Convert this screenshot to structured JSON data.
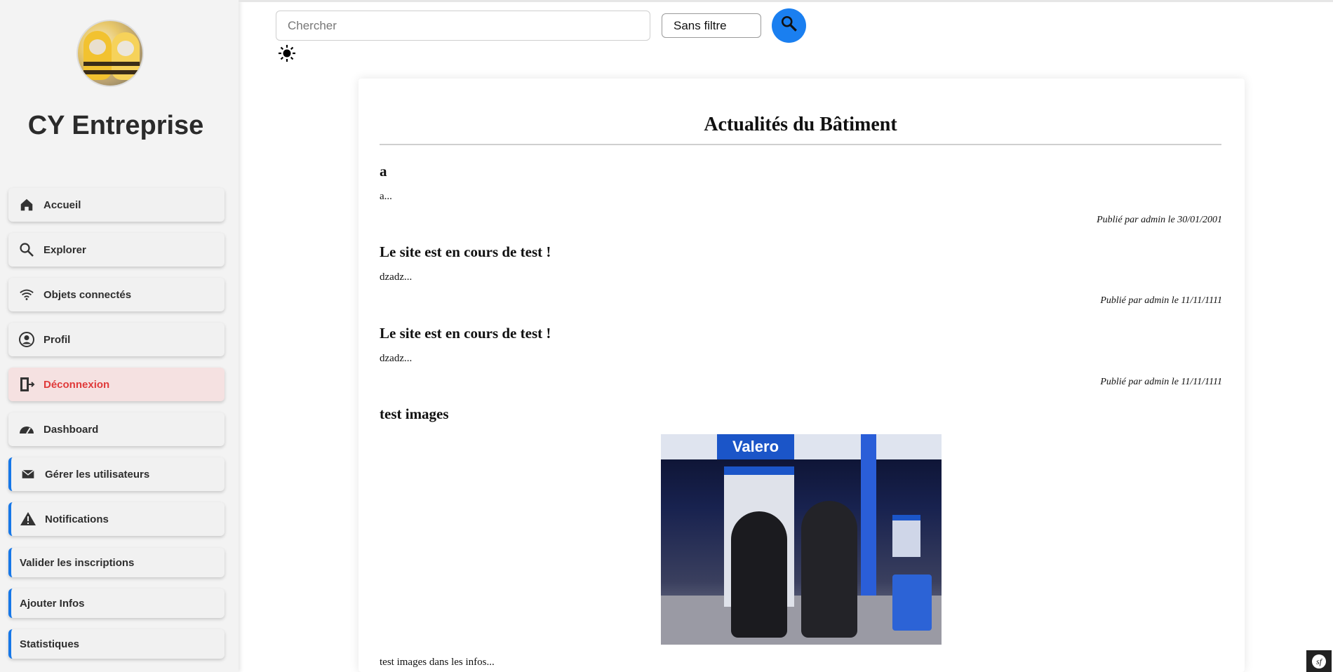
{
  "sidebar": {
    "brand": "CY Entreprise",
    "avatar_alt": "avatar",
    "items": [
      {
        "label": "Accueil",
        "icon": "home-icon"
      },
      {
        "label": "Explorer",
        "icon": "search-icon"
      },
      {
        "label": "Objets connectés",
        "icon": "wifi-icon"
      },
      {
        "label": "Profil",
        "icon": "user-circle-icon"
      },
      {
        "label": "Déconnexion",
        "icon": "logout-icon"
      },
      {
        "label": "Dashboard",
        "icon": "gauge-icon"
      },
      {
        "label": "Gérer les utilisateurs",
        "icon": "mail-icon"
      },
      {
        "label": "Notifications",
        "icon": "warning-icon"
      },
      {
        "label": "Valider les inscriptions"
      },
      {
        "label": "Ajouter Infos"
      },
      {
        "label": "Statistiques"
      }
    ]
  },
  "search": {
    "placeholder": "Chercher",
    "value": "",
    "filter": "Sans filtre"
  },
  "colors": {
    "accent": "#1a7ff0",
    "logout_text": "#e03a3a",
    "logout_bg": "#f5e1e1",
    "admin_border": "#1677e8"
  },
  "news": {
    "title": "Actualités du Bâtiment",
    "articles": [
      {
        "title": "a",
        "body": "a...",
        "meta": "Publié par admin le 30/01/2001"
      },
      {
        "title": "Le site est en cours de test !",
        "body": "dzadz...",
        "meta": "Publié par admin le 11/11/1111"
      },
      {
        "title": "Le site est en cours de test !",
        "body": "dzadz...",
        "meta": "Publié par admin le 11/11/1111"
      },
      {
        "title": "test images",
        "body": "test images dans les infos...",
        "image_sign": "Valero"
      }
    ]
  }
}
